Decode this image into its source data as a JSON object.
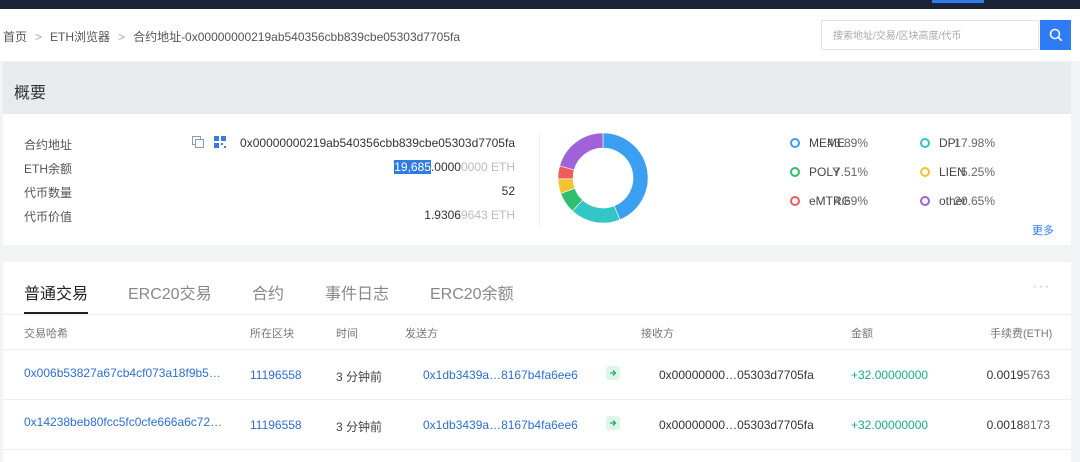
{
  "breadcrumb": {
    "home": "首页",
    "explorer": "ETH浏览器",
    "current": "合约地址-0x00000000219ab540356cbb839cbe05303d7705fa"
  },
  "search": {
    "placeholder": "搜索地址/交易/区块高度/代币"
  },
  "overview": {
    "title": "概要",
    "labels": {
      "address": "合约地址",
      "eth_balance": "ETH余额",
      "token_count": "代币数量",
      "token_value": "代币价值"
    },
    "address": "0x00000000219ab540356cbb839cbe05303d7705fa",
    "eth_balance": {
      "main": "19,685",
      "mid": ".0000",
      "faint": "0000 ETH"
    },
    "token_count": "52",
    "token_value": {
      "main": "1.9306",
      "faint": "9643 ETH"
    },
    "more": "更多",
    "legend": [
      {
        "name": "MEME",
        "pct": "43.89%",
        "color": "#3a9ff0"
      },
      {
        "name": "DPI",
        "pct": "17.98%",
        "color": "#33c6c6"
      },
      {
        "name": "POLY",
        "pct": "7.51%",
        "color": "#2fbf71"
      },
      {
        "name": "LIEN",
        "pct": "5.25%",
        "color": "#f5c230"
      },
      {
        "name": "eMTRG",
        "pct": "4.69%",
        "color": "#ee5b5b"
      },
      {
        "name": "other",
        "pct": "20.65%",
        "color": "#9f62d9"
      }
    ]
  },
  "chart_data": {
    "type": "pie",
    "categories": [
      "MEME",
      "DPI",
      "POLY",
      "LIEN",
      "eMTRG",
      "other"
    ],
    "values": [
      43.89,
      17.98,
      7.51,
      5.25,
      4.69,
      20.65
    ]
  },
  "tabs": {
    "normal_tx": "普通交易",
    "erc20_tx": "ERC20交易",
    "contract": "合约",
    "event_log": "事件日志",
    "erc20_balance": "ERC20余额"
  },
  "table": {
    "headers": {
      "hash": "交易哈希",
      "block": "所在区块",
      "time": "时间",
      "from": "发送方",
      "to": "接收方",
      "amount": "金额",
      "fee": "手续费(ETH)"
    },
    "rows": [
      {
        "hash": "0x006b53827a67cb4cf073a18f9b5…",
        "block": "11196558",
        "time": "3 分钟前",
        "from": "0x1db3439a…8167b4fa6ee6",
        "to": "0x00000000…05303d7705fa",
        "amount": "+32.00000000",
        "fee_main": "0.0019",
        "fee_faint": "5763"
      },
      {
        "hash": "0x14238beb80fcc5fc0cfe666a6c72…",
        "block": "11196558",
        "time": "3 分钟前",
        "from": "0x1db3439a…8167b4fa6ee6",
        "to": "0x00000000…05303d7705fa",
        "amount": "+32.00000000",
        "fee_main": "0.0018",
        "fee_faint": "8173"
      }
    ]
  }
}
